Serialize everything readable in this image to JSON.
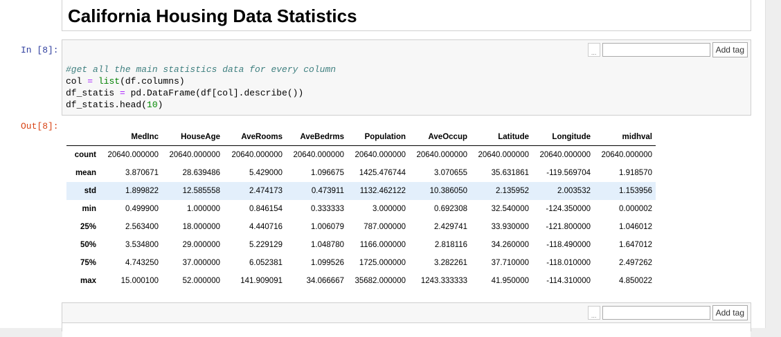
{
  "title": "California Housing Data Statistics",
  "cell1": {
    "in_prompt": "In [8]:",
    "out_prompt": "Out[8]:",
    "tag_dots": "...",
    "tag_input_value": "",
    "add_tag_label": "Add tag",
    "code": {
      "line1": "#get all the main statistics data for every column",
      "line2a": "col ",
      "line2b": "=",
      "line2c": " ",
      "line2d": "list",
      "line2e": "(df.columns)",
      "line3a": "df_statis ",
      "line3b": "=",
      "line3c": " pd.DataFrame(df[col].describe())",
      "line4a": "df_statis.head(",
      "line4b": "10",
      "line4c": ")"
    }
  },
  "table": {
    "columns": [
      "",
      "MedInc",
      "HouseAge",
      "AveRooms",
      "AveBedrms",
      "Population",
      "AveOccup",
      "Latitude",
      "Longitude",
      "midhval"
    ],
    "rows": [
      [
        "count",
        "20640.000000",
        "20640.000000",
        "20640.000000",
        "20640.000000",
        "20640.000000",
        "20640.000000",
        "20640.000000",
        "20640.000000",
        "20640.000000"
      ],
      [
        "mean",
        "3.870671",
        "28.639486",
        "5.429000",
        "1.096675",
        "1425.476744",
        "3.070655",
        "35.631861",
        "-119.569704",
        "1.918570"
      ],
      [
        "std",
        "1.899822",
        "12.585558",
        "2.474173",
        "0.473911",
        "1132.462122",
        "10.386050",
        "2.135952",
        "2.003532",
        "1.153956"
      ],
      [
        "min",
        "0.499900",
        "1.000000",
        "0.846154",
        "0.333333",
        "3.000000",
        "0.692308",
        "32.540000",
        "-124.350000",
        "0.000002"
      ],
      [
        "25%",
        "2.563400",
        "18.000000",
        "4.440716",
        "1.006079",
        "787.000000",
        "2.429741",
        "33.930000",
        "-121.800000",
        "1.046012"
      ],
      [
        "50%",
        "3.534800",
        "29.000000",
        "5.229129",
        "1.048780",
        "1166.000000",
        "2.818116",
        "34.260000",
        "-118.490000",
        "1.647012"
      ],
      [
        "75%",
        "4.743250",
        "37.000000",
        "6.052381",
        "1.099526",
        "1725.000000",
        "3.282261",
        "37.710000",
        "-118.010000",
        "2.497262"
      ],
      [
        "max",
        "15.000100",
        "52.000000",
        "141.909091",
        "34.066667",
        "35682.000000",
        "1243.333333",
        "41.950000",
        "-114.310000",
        "4.850022"
      ]
    ]
  },
  "cell2": {
    "tag_dots": "...",
    "tag_input_value": "",
    "add_tag_label": "Add tag"
  }
}
